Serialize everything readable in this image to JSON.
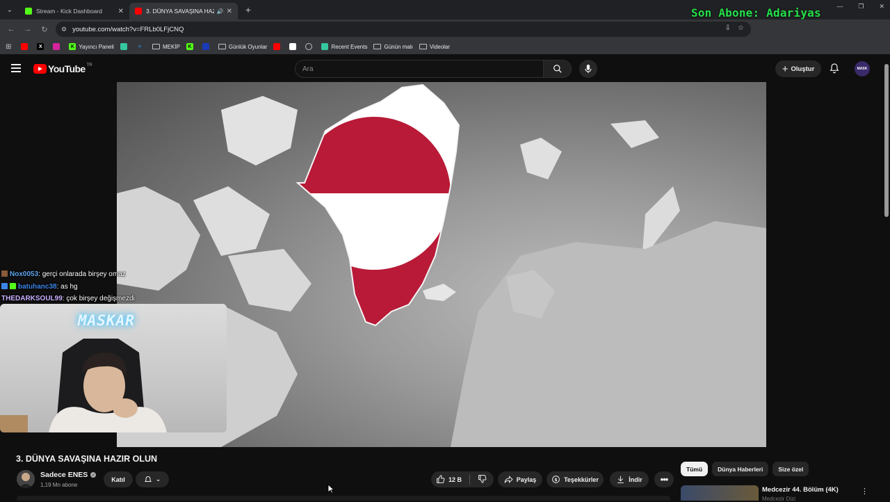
{
  "browser": {
    "tabs": [
      {
        "title": "Stream - Kick Dashboard",
        "favicon_color": "#53fc18",
        "active": false
      },
      {
        "title": "3. DÜNYA SAVAŞINA HAZIR",
        "favicon_color": "#ff0000",
        "active": true
      }
    ],
    "url": "youtube.com/watch?v=FRLb0LFjCNQ",
    "bookmarks": [
      {
        "label": "",
        "icon": "youtube-icon",
        "color": "#ff0000"
      },
      {
        "label": "",
        "icon": "x-icon",
        "color": "#000000"
      },
      {
        "label": "",
        "icon": "instagram-icon",
        "color": "#d6249f"
      },
      {
        "label": "Yayıncı Paneli",
        "icon": "kick-icon",
        "color": "#53fc18"
      },
      {
        "label": "",
        "icon": "bookmark-icon",
        "color": "#35c7a0"
      },
      {
        "label": "",
        "icon": "bookmark-icon",
        "color": "#2196f3"
      },
      {
        "label": "MEKİP",
        "icon": "folder-icon",
        "color": "#bdc1c6"
      },
      {
        "label": "",
        "icon": "kick-icon",
        "color": "#53fc18"
      },
      {
        "label": "",
        "icon": "bookmark-icon",
        "color": "#1a3ab8"
      },
      {
        "label": "Günlük Oyunlar",
        "icon": "folder-icon",
        "color": "#bdc1c6"
      },
      {
        "label": "",
        "icon": "youtube-icon",
        "color": "#ff0000"
      },
      {
        "label": "",
        "icon": "bookmark-icon",
        "color": "#ffffff"
      },
      {
        "label": "",
        "icon": "globe-icon",
        "color": "#bdc1c6"
      },
      {
        "label": "Recent Events",
        "icon": "bookmark-icon",
        "color": "#35c7a0"
      },
      {
        "label": "Günün malı",
        "icon": "folder-icon",
        "color": "#bdc1c6"
      },
      {
        "label": "Videolar",
        "icon": "folder-icon",
        "color": "#bdc1c6"
      }
    ]
  },
  "overlay": {
    "last_sub": "Son Abone: Adariyas",
    "chat": [
      {
        "user": "Nox0053",
        "text": ": gerçi onlarada birşey omaz"
      },
      {
        "user": "batuhanc38",
        "text": ": as hg"
      },
      {
        "user": "THEDARKSOUL99",
        "text": ": çok birşey değişmezdi"
      }
    ],
    "webcam_sign": "MASKAR"
  },
  "youtube": {
    "logo": "YouTube",
    "country": "TR",
    "search_placeholder": "Ara",
    "create_label": "Oluştur",
    "avatar_text": "MASK",
    "video_title": "3. DÜNYA SAVAŞINA HAZIR OLUN",
    "channel_name": "Sadece ENES",
    "subscribers": "1,19 Mn abone",
    "join_label": "Katıl",
    "likes": "12 B",
    "share_label": "Paylaş",
    "thanks_label": "Teşekkürler",
    "download_label": "İndir",
    "chips": [
      "Tümü",
      "Dünya Haberleri",
      "Size özel"
    ],
    "recommended": {
      "title": "Medcezir 44. Bölüm (4K)",
      "channel": "Medcezir Dizi"
    }
  }
}
